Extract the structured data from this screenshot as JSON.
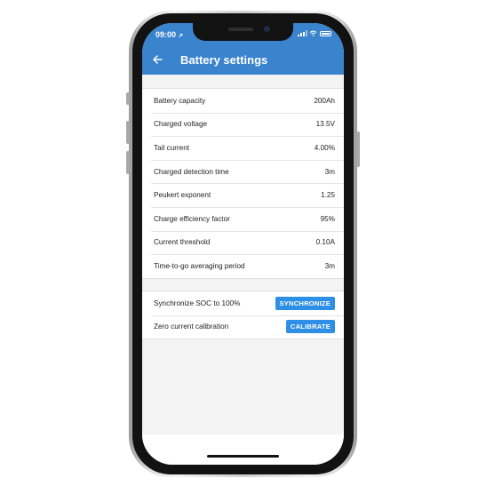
{
  "status_bar": {
    "time": "09:00",
    "location_glyph": "➚"
  },
  "header": {
    "back_icon": "arrow-left-icon",
    "title": "Battery settings"
  },
  "colors": {
    "header": "#3a83cd",
    "button": "#2e8fe6",
    "background": "#f3f3f3"
  },
  "settings": [
    {
      "label": "Battery capacity",
      "value": "200Ah"
    },
    {
      "label": "Charged voltage",
      "value": "13.5V"
    },
    {
      "label": "Tail current",
      "value": "4.00%"
    },
    {
      "label": "Charged detection time",
      "value": "3m"
    },
    {
      "label": "Peukert exponent",
      "value": "1.25"
    },
    {
      "label": "Charge efficiency factor",
      "value": "95%"
    },
    {
      "label": "Current threshold",
      "value": "0.10A"
    },
    {
      "label": "Time-to-go averaging period",
      "value": "3m"
    }
  ],
  "actions": [
    {
      "label": "Synchronize SOC to 100%",
      "button": "SYNCHRONIZE"
    },
    {
      "label": "Zero current calibration",
      "button": "CALIBRATE"
    }
  ]
}
